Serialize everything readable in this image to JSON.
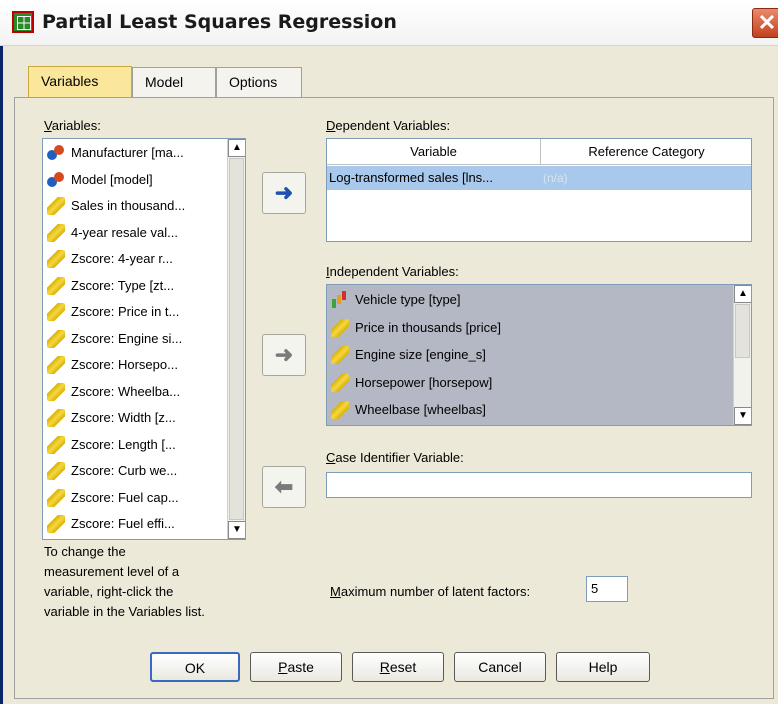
{
  "window": {
    "title": "Partial Least Squares Regression",
    "close_glyph": "✕"
  },
  "tabs": [
    {
      "label": "Variables",
      "active": true
    },
    {
      "label": "Model",
      "active": false
    },
    {
      "label": "Options",
      "active": false
    }
  ],
  "variables_panel": {
    "label_prefix": "V",
    "label_rest": "ariables:",
    "items": [
      {
        "icon": "nominal-icon",
        "label": "Manufacturer [ma..."
      },
      {
        "icon": "nominal-icon",
        "label": "Model [model]"
      },
      {
        "icon": "scale-icon",
        "label": "Sales in thousand..."
      },
      {
        "icon": "scale-icon",
        "label": "4-year resale val..."
      },
      {
        "icon": "scale-icon",
        "label": "Zscore:  4-year r..."
      },
      {
        "icon": "scale-icon",
        "label": "Zscore:  Type [zt..."
      },
      {
        "icon": "scale-icon",
        "label": "Zscore:  Price in t..."
      },
      {
        "icon": "scale-icon",
        "label": "Zscore:  Engine si..."
      },
      {
        "icon": "scale-icon",
        "label": "Zscore:  Horsepo..."
      },
      {
        "icon": "scale-icon",
        "label": "Zscore:  Wheelba..."
      },
      {
        "icon": "scale-icon",
        "label": "Zscore:  Width [z..."
      },
      {
        "icon": "scale-icon",
        "label": "Zscore:  Length [..."
      },
      {
        "icon": "scale-icon",
        "label": "Zscore:  Curb we..."
      },
      {
        "icon": "scale-icon",
        "label": "Zscore:  Fuel cap..."
      },
      {
        "icon": "scale-icon",
        "label": "Zscore:  Fuel effi..."
      }
    ],
    "help_text": [
      "To change the",
      "measurement level of a",
      "variable, right-click the",
      "variable in the Variables list."
    ]
  },
  "dependent": {
    "label_prefix": "D",
    "label_rest": "ependent Variables:",
    "columns": [
      "Variable",
      "Reference Category"
    ],
    "rows": [
      {
        "variable": "Log-transformed sales [lns...",
        "reference": "(n/a)"
      }
    ]
  },
  "independent": {
    "label_prefix": "I",
    "label_rest": "ndependent Variables:",
    "items": [
      {
        "icon": "bar-chart-icon",
        "label": "Vehicle type [type]"
      },
      {
        "icon": "scale-icon",
        "label": "Price in thousands [price]"
      },
      {
        "icon": "scale-icon",
        "label": "Engine size [engine_s]"
      },
      {
        "icon": "scale-icon",
        "label": "Horsepower [horsepow]"
      },
      {
        "icon": "scale-icon",
        "label": "Wheelbase [wheelbas]"
      }
    ]
  },
  "case_identifier": {
    "label_prefix": "C",
    "label_rest": "ase Identifier Variable:",
    "value": ""
  },
  "latent_factors": {
    "label_prefix": "M",
    "label_rest": "aximum number of latent factors:",
    "value": "5"
  },
  "arrows": {
    "right": "➜",
    "left": "⬅"
  },
  "scroll": {
    "up": "▲",
    "down": "▼"
  },
  "buttons": {
    "ok": "OK",
    "paste_prefix": "P",
    "paste_rest": "aste",
    "reset_prefix": "R",
    "reset_rest": "eset",
    "cancel": "Cancel",
    "help": "Help"
  }
}
